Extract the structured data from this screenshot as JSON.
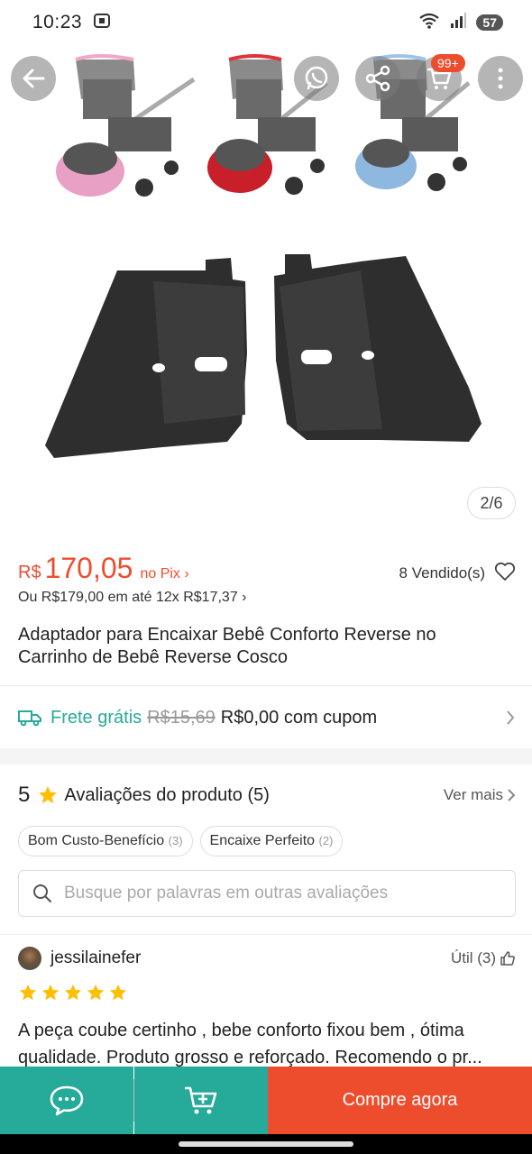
{
  "status_bar": {
    "time": "10:23",
    "battery": "57"
  },
  "header": {
    "cart_badge": "99+"
  },
  "gallery": {
    "counter": "2/6"
  },
  "price": {
    "currency": "R$",
    "value": "170,05",
    "pix_label": "no Pix ›",
    "sold": "8 Vendido(s)",
    "installments": "Ou R$179,00 em até 12x R$17,37 ›"
  },
  "product": {
    "title": "Adaptador para Encaixar Bebê Conforto Reverse no Carrinho de Bebê Reverse Cosco"
  },
  "shipping": {
    "free_label": "Frete grátis",
    "old_price": "R$15,69",
    "new_price": "R$0,00 com cupom"
  },
  "reviews": {
    "score": "5",
    "title": "Avaliações do produto (5)",
    "see_more": "Ver mais",
    "chips": [
      {
        "label": "Bom Custo-Benefício",
        "count": "(3)"
      },
      {
        "label": "Encaixe Perfeito",
        "count": "(2)"
      }
    ],
    "search_placeholder": "Busque por palavras em outras avaliações",
    "first": {
      "user": "jessilainefer",
      "useful": "Útil (3)",
      "stars": 5,
      "text": "A peça coube certinho , bebe conforto fixou bem , ótima qualidade. Produto grosso e reforçado. Recomendo o pr..."
    }
  },
  "bottom_bar": {
    "buy_label": "Compre agora"
  },
  "colors": {
    "accent": "#ee4d2d",
    "teal": "#26aa99"
  }
}
